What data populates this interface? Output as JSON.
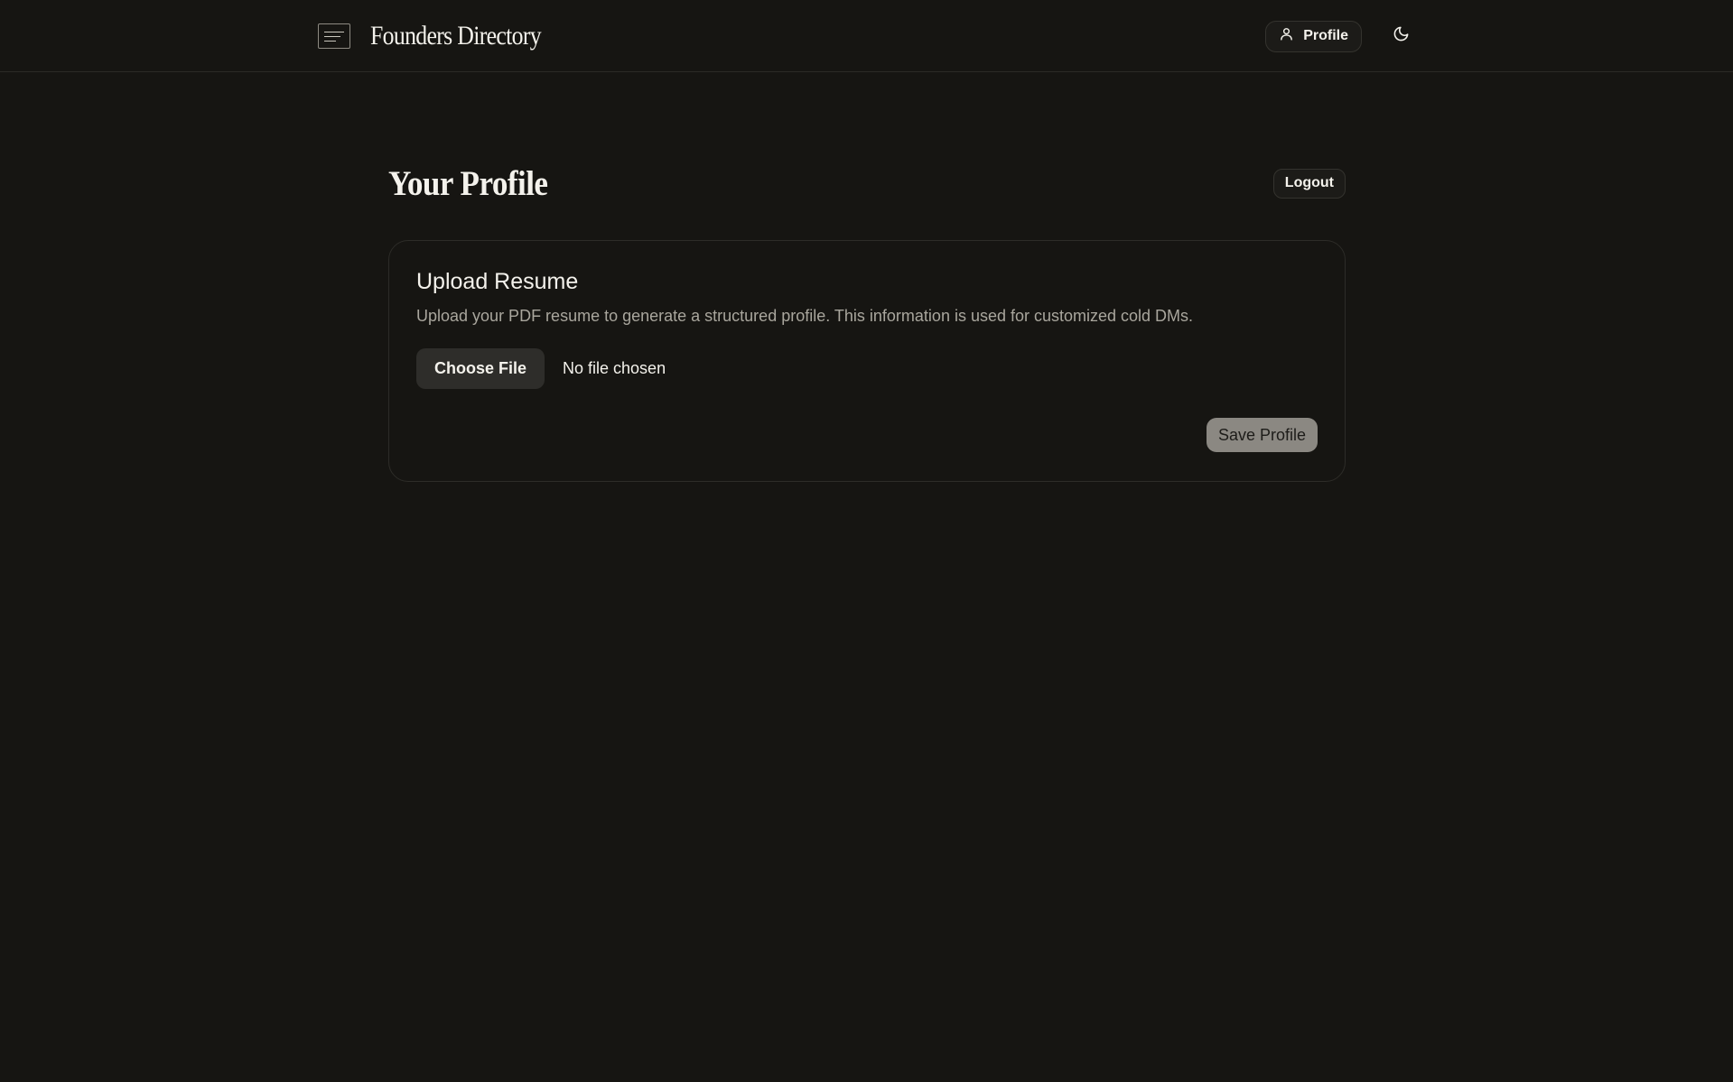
{
  "header": {
    "brand_name": "Founders Directory",
    "profile_label": "Profile",
    "icons": {
      "logo": "menu-lines-icon",
      "profile": "user-icon",
      "theme": "moon-icon"
    }
  },
  "page": {
    "title": "Your Profile",
    "logout_label": "Logout"
  },
  "card": {
    "title": "Upload Resume",
    "description": "Upload your PDF resume to generate a structured profile. This information is used for customized cold DMs.",
    "choose_file_label": "Choose File",
    "file_status": "No file chosen",
    "save_label": "Save Profile"
  },
  "colors": {
    "background": "#161512",
    "text": "#f4f2ec",
    "muted_text": "#a9a69d",
    "border": "#2d2c28",
    "save_button_bg": "#8b8882"
  }
}
